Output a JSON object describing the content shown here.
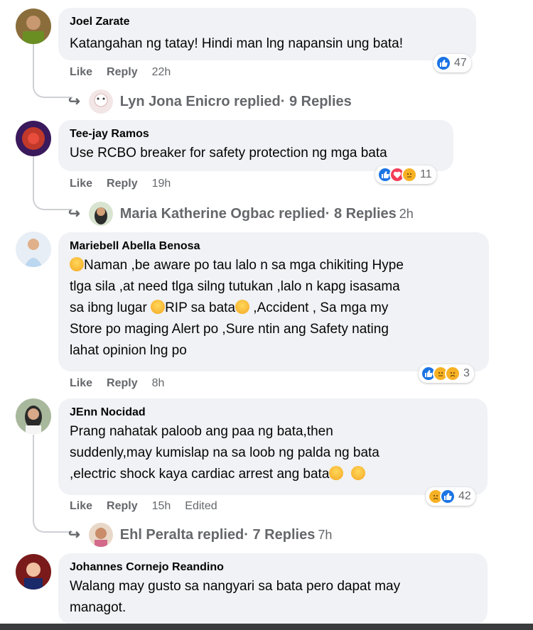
{
  "comments": [
    {
      "author": "Joel Zarate",
      "text": "Katangahan ng tatay! Hindi man lng napansin ung bata!",
      "like_label": "Like",
      "reply_label": "Reply",
      "time": "22h",
      "reaction_count": "47",
      "replies_summary": {
        "name": "Lyn Jona Enicro replied",
        "count": " · 9 Replies",
        "time": ""
      }
    },
    {
      "author": "Tee-jay Ramos",
      "text": "Use RCBO breaker for safety protection ng mga bata",
      "like_label": "Like",
      "reply_label": "Reply",
      "time": "19h",
      "reaction_count": "11",
      "replies_summary": {
        "name": "Maria Katherine Ogbac replied",
        "count": " · 8 Replies",
        "time": "2h"
      }
    },
    {
      "author": "Mariebell Abella Benosa",
      "text_lines": [
        "Naman ,be aware po tau lalo n sa mga chikiting Hype",
        "tlga sila ,at need tlga silng tutukan ,lalo n kapg isasama",
        "sa ibng lugar",
        "RIP sa bata",
        " ,Accident , Sa mga my",
        "Store po maging Alert po ,Sure ntin ang Safety nating",
        "lahat opinion lng po"
      ],
      "like_label": "Like",
      "reply_label": "Reply",
      "time": "8h",
      "reaction_count": "3"
    },
    {
      "author": "JEnn Nocidad",
      "text_lines": [
        "Prang nahatak paloob ang paa ng bata,then",
        "suddenly,may kumislap na sa loob ng palda ng bata",
        ",electric shock kaya cardiac arrest ang bata"
      ],
      "like_label": "Like",
      "reply_label": "Reply",
      "time": "15h",
      "edited": "Edited",
      "reaction_count": "42",
      "replies_summary": {
        "name": "Ehl Peralta replied",
        "count": " · 7 Replies",
        "time": "7h"
      }
    },
    {
      "author": "Johannes Cornejo Reandino",
      "text_lines": [
        "Walang may gusto sa nangyari sa bata pero dapat may",
        "managot."
      ]
    }
  ],
  "icons": {
    "reply_arrow": "reply-arrow-icon",
    "like": "like-reaction-icon",
    "love": "love-reaction-icon",
    "care": "care-reaction-icon",
    "sad": "sad-reaction-icon",
    "haha": "haha-reaction-icon"
  },
  "colors": {
    "bubble": "#f0f2f5",
    "secondary_text": "#65676b",
    "like_blue": "#1b74e4",
    "love_red": "#f33e58",
    "emoji_yellow": "#f7b125"
  }
}
